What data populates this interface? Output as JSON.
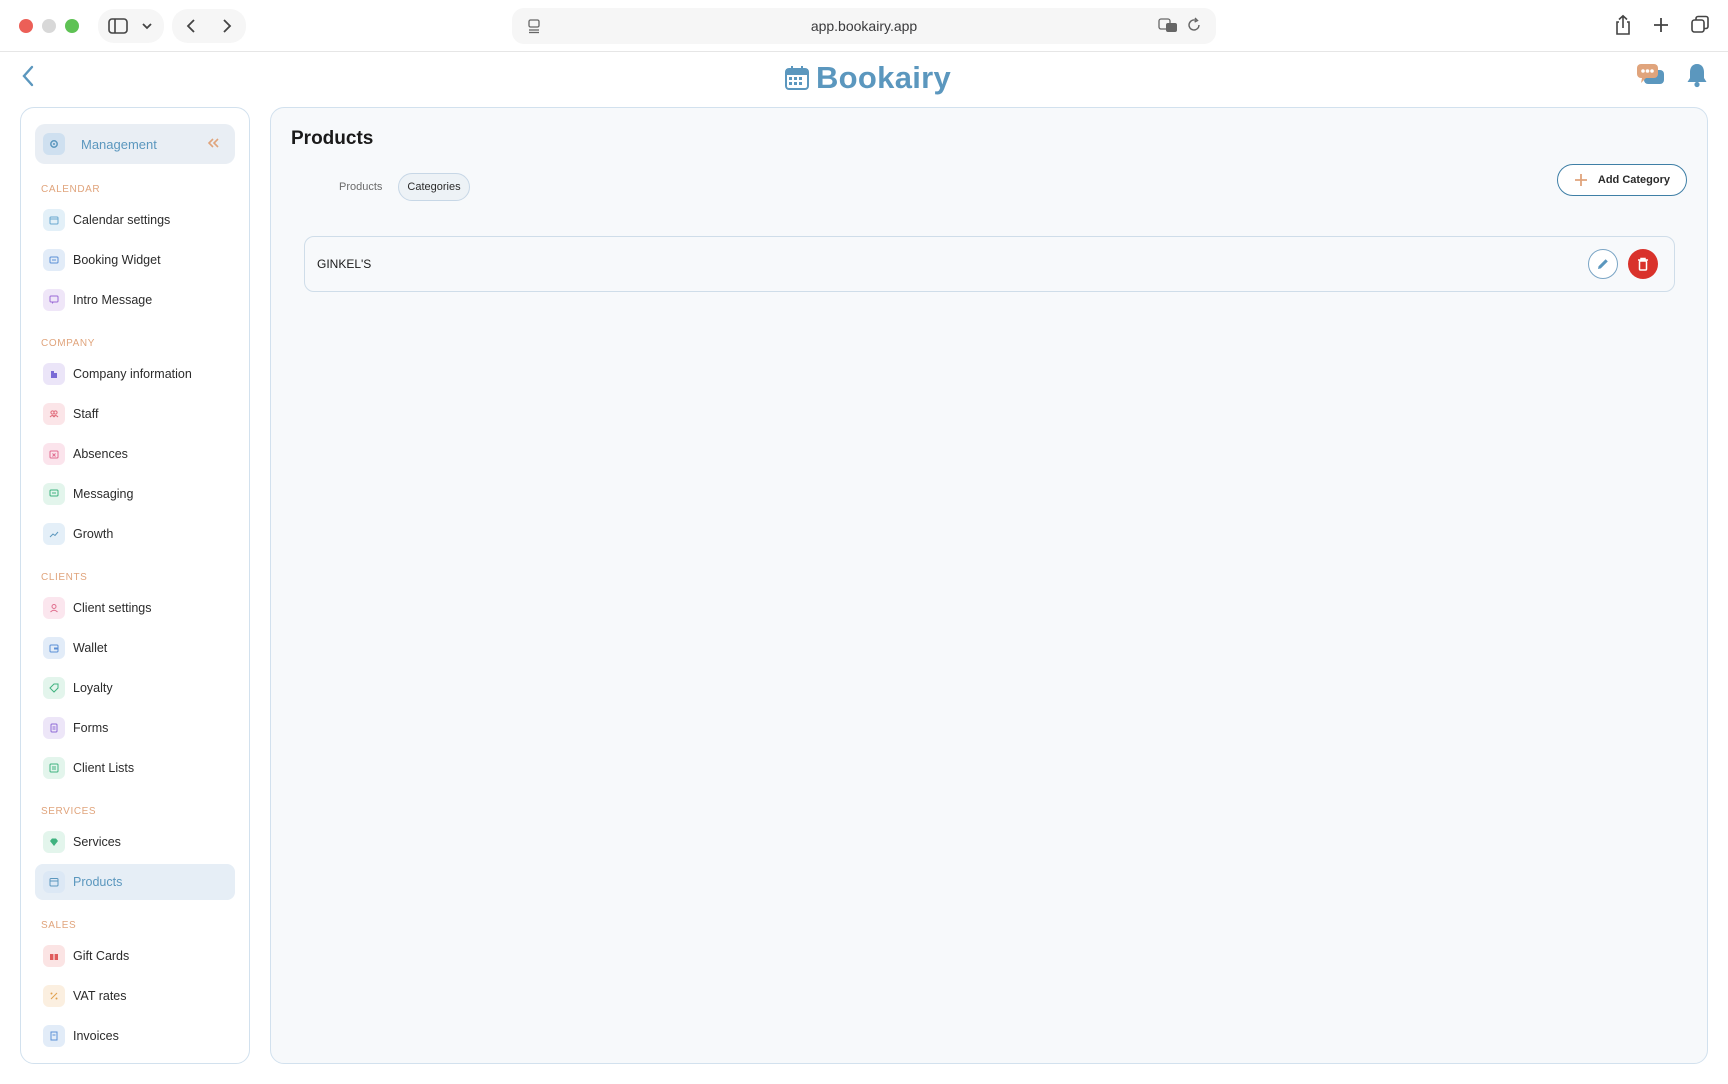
{
  "browser": {
    "url": "app.bookairy.app"
  },
  "app": {
    "logo_text": "Bookairy",
    "colors": {
      "accent": "#5b97be",
      "section": "#e0a47c",
      "danger": "#d9322b"
    }
  },
  "sidebar": {
    "header_label": "Management",
    "sections": [
      {
        "title": "CALENDAR",
        "items": [
          {
            "label": "Calendar settings",
            "icon": "calendar-icon",
            "color": "#e3f0f8"
          },
          {
            "label": "Booking Widget",
            "icon": "widget-icon",
            "color": "#e2ecf8"
          },
          {
            "label": "Intro Message",
            "icon": "message-icon",
            "color": "#efe6f8"
          }
        ]
      },
      {
        "title": "COMPANY",
        "items": [
          {
            "label": "Company information",
            "icon": "building-icon",
            "color": "#ebe5f8"
          },
          {
            "label": "Staff",
            "icon": "users-icon",
            "color": "#fbe5e8"
          },
          {
            "label": "Absences",
            "icon": "calendar-x-icon",
            "color": "#fbe4ec"
          },
          {
            "label": "Messaging",
            "icon": "chat-icon",
            "color": "#e3f5ec"
          },
          {
            "label": "Growth",
            "icon": "trend-icon",
            "color": "#e4eff8"
          }
        ]
      },
      {
        "title": "CLIENTS",
        "items": [
          {
            "label": "Client settings",
            "icon": "user-icon",
            "color": "#fbe6ee"
          },
          {
            "label": "Wallet",
            "icon": "wallet-icon",
            "color": "#e2ecf8"
          },
          {
            "label": "Loyalty",
            "icon": "tag-icon",
            "color": "#e3f5ec"
          },
          {
            "label": "Forms",
            "icon": "form-icon",
            "color": "#ede6f8"
          },
          {
            "label": "Client Lists",
            "icon": "list-icon",
            "color": "#e3f5ec"
          }
        ]
      },
      {
        "title": "SERVICES",
        "items": [
          {
            "label": "Services",
            "icon": "diamond-icon",
            "color": "#e3f5ec"
          },
          {
            "label": "Products",
            "icon": "box-icon",
            "color": "#dce8f5",
            "active": true
          }
        ]
      },
      {
        "title": "SALES",
        "items": [
          {
            "label": "Gift Cards",
            "icon": "gift-icon",
            "color": "#fbe4e4"
          },
          {
            "label": "VAT rates",
            "icon": "percent-icon",
            "color": "#fbefe0"
          },
          {
            "label": "Invoices",
            "icon": "invoice-icon",
            "color": "#e2ecf8"
          }
        ]
      }
    ]
  },
  "main": {
    "title": "Products",
    "tabs": [
      {
        "label": "Products",
        "active": false
      },
      {
        "label": "Categories",
        "active": true
      }
    ],
    "add_button_label": "Add Category",
    "categories": [
      {
        "name": "GINKEL'S"
      }
    ]
  }
}
